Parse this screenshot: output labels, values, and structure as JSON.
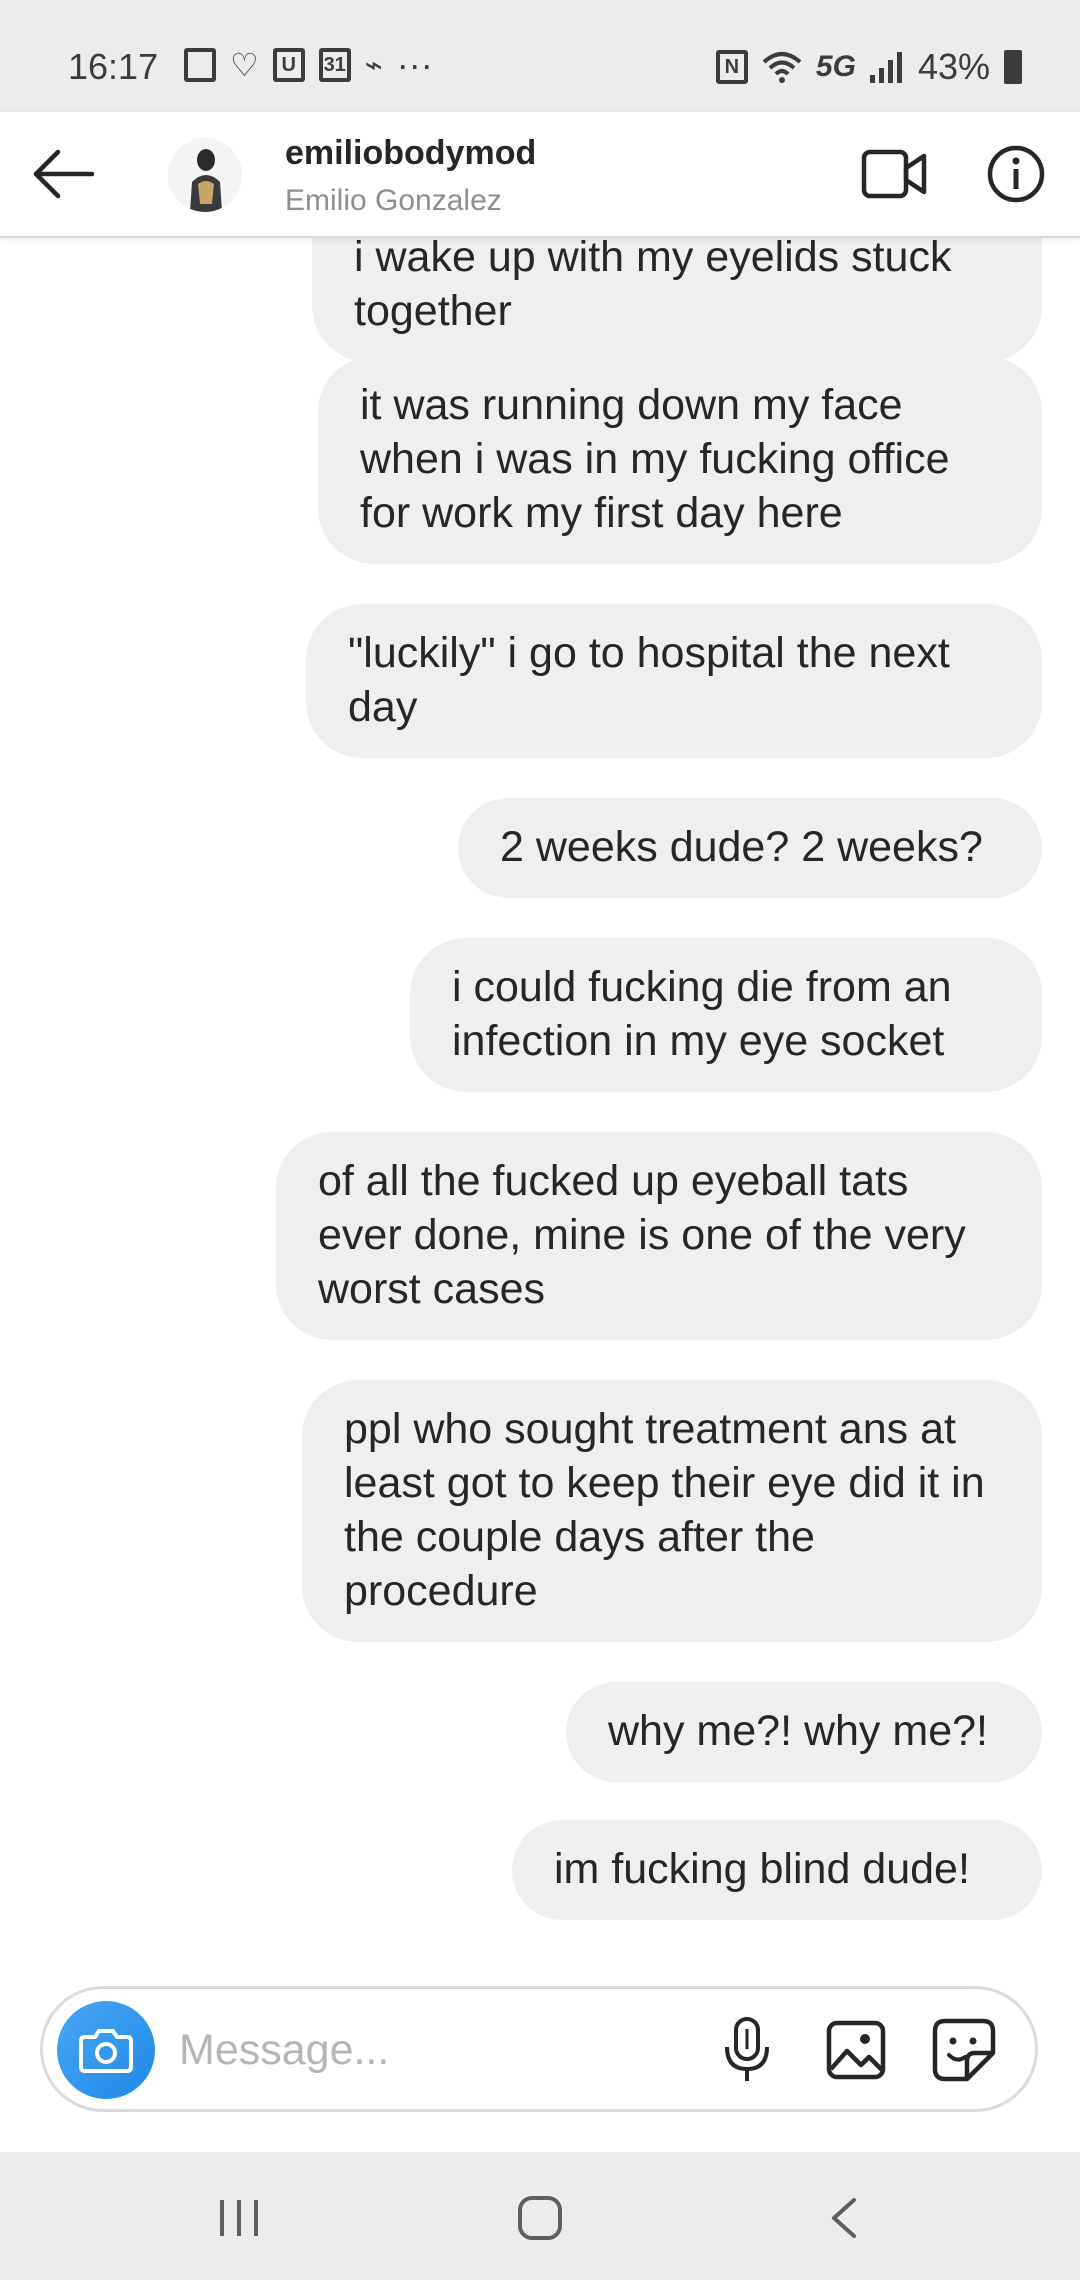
{
  "status_bar": {
    "time": "16:17",
    "network": "5G",
    "battery": "43%",
    "calendar_date": "31",
    "more": "···"
  },
  "header": {
    "username": "emiliobodymod",
    "full_name": "Emilio Gonzalez"
  },
  "messages": [
    {
      "text": "i wake up with my eyelids stuck together"
    },
    {
      "text": "it was running down my face when i was in my fucking office for work my first day here"
    },
    {
      "text": "\"luckily\" i go to hospital the next day"
    },
    {
      "text": "2 weeks dude? 2 weeks?"
    },
    {
      "text": "i could fucking die from an infection in my eye socket"
    },
    {
      "text": "of all the fucked up eyeball tats ever done, mine is one of the very worst cases"
    },
    {
      "text": "ppl who sought treatment ans at least got to keep their eye did it in the couple days after the procedure"
    },
    {
      "text": "why me?! why me?!"
    },
    {
      "text": "im fucking blind dude!"
    }
  ],
  "composer": {
    "placeholder": "Message..."
  },
  "icons": {
    "back": "arrow-left-icon",
    "video": "video-camera-icon",
    "info": "info-icon",
    "camera": "camera-icon",
    "mic": "microphone-icon",
    "gallery": "image-icon",
    "sticker": "sticker-icon"
  },
  "colors": {
    "bubble": "#efefef",
    "camera_button": "#1e88e5",
    "secondary_text": "#8e8e8e"
  }
}
